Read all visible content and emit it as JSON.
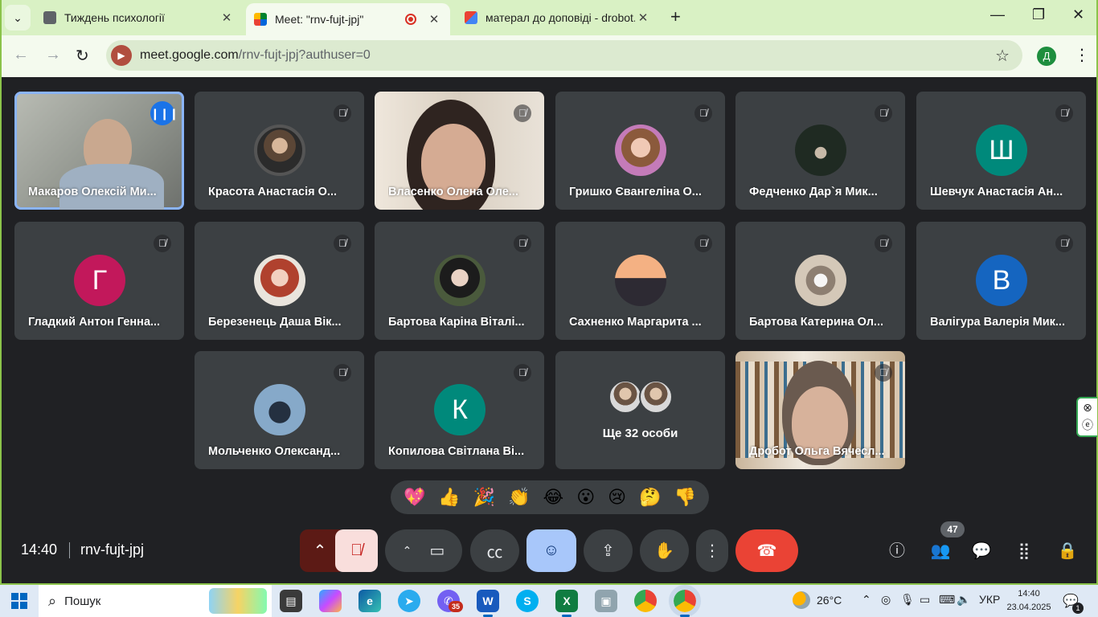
{
  "browser": {
    "tabs": [
      {
        "title": "Тиждень психології",
        "active": false
      },
      {
        "title": "Meet: \"rnv-fujt-jpj\"",
        "active": true,
        "recording": true
      },
      {
        "title": "матерал до доповіді - drobot.o",
        "active": false
      }
    ],
    "url_host": "meet.google.com",
    "url_path": "/rnv-fujt-jpj?authuser=0",
    "profile_initial": "Д",
    "accent_color": "#8bc34a"
  },
  "participants": [
    {
      "name": "Макаров Олексій Ми...",
      "speaking": true,
      "kind": "video"
    },
    {
      "name": "Красота Анастасія О...",
      "kind": "photo"
    },
    {
      "name": "Власенко Олена Оле...",
      "kind": "video"
    },
    {
      "name": "Гришко Євангеліна О...",
      "kind": "photo"
    },
    {
      "name": "Федченко Дар`я Мик...",
      "kind": "photo"
    },
    {
      "name": "Шевчук Анастасія Ан...",
      "kind": "letter",
      "letter": "Ш",
      "color": "#00897b"
    },
    {
      "name": "Гладкий Антон Генна...",
      "kind": "letter",
      "letter": "Г",
      "color": "#c2185b"
    },
    {
      "name": "Березенець Даша Вік...",
      "kind": "photo"
    },
    {
      "name": "Бартова Каріна Віталі...",
      "kind": "photo"
    },
    {
      "name": "Сахненко Маргарита ...",
      "kind": "photo"
    },
    {
      "name": "Бартова Катерина Ол...",
      "kind": "photo"
    },
    {
      "name": "Валігура Валерія Мик...",
      "kind": "letter",
      "letter": "В",
      "color": "#1565c0"
    },
    {
      "name": "Мольченко Олександ...",
      "kind": "photo"
    },
    {
      "name": "Копилова Світлана Ві...",
      "kind": "letter",
      "letter": "К",
      "color": "#00897b"
    },
    {
      "name": "Ще 32 особи",
      "kind": "more"
    },
    {
      "name": "Дробот Ольга Вячесл...",
      "kind": "video"
    }
  ],
  "reactions": [
    "💖",
    "👍",
    "🎉",
    "👏",
    "😂",
    "😮",
    "😢",
    "🤔",
    "👎"
  ],
  "meeting": {
    "time": "14:40",
    "code": "rnv-fujt-jpj",
    "people_count": "47"
  },
  "taskbar": {
    "search_label": "Пошук",
    "viber_badge": "35",
    "temperature": "26°C",
    "language": "УКР",
    "time": "14:40",
    "date": "23.04.2025",
    "notifications": "1"
  }
}
